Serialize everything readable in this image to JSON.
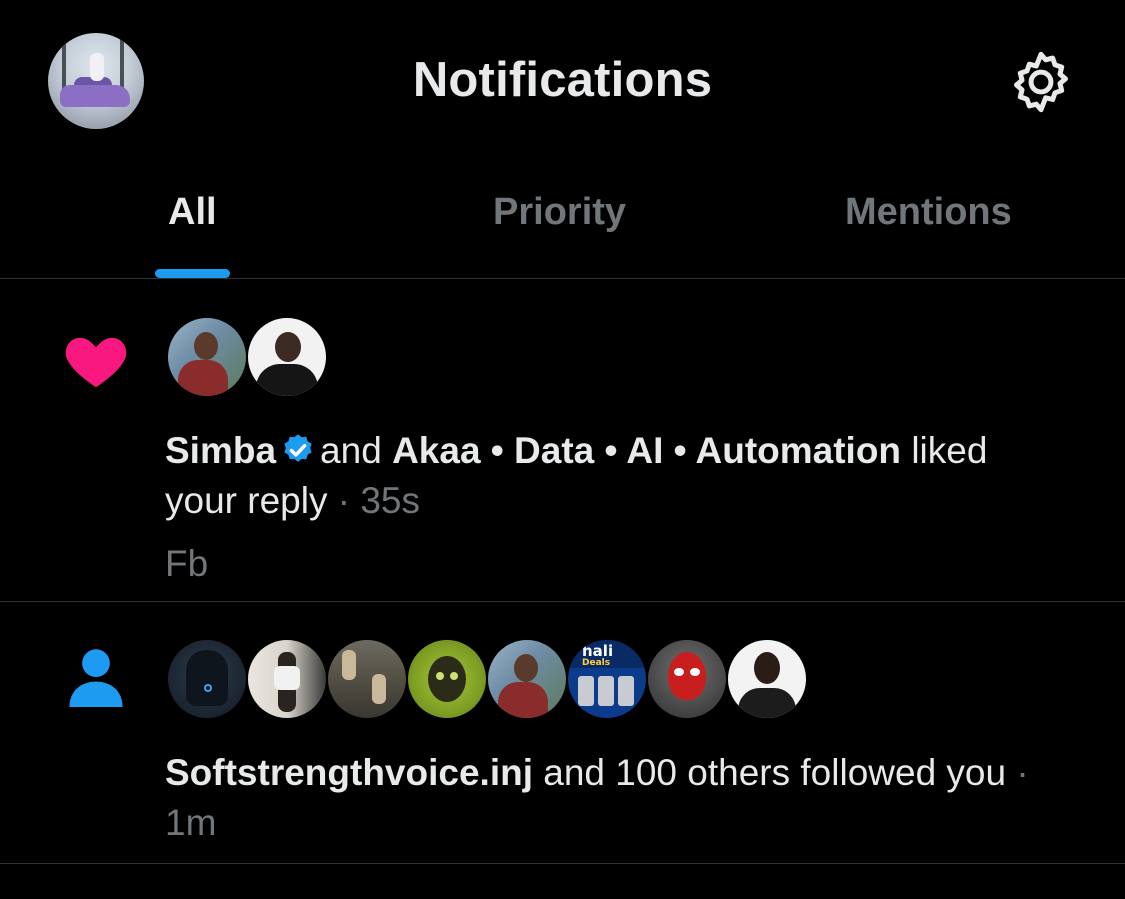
{
  "header": {
    "title": "Notifications",
    "profile_icon": "avatar",
    "settings_icon": "gear-icon"
  },
  "tabs": [
    {
      "label": "All",
      "active": true
    },
    {
      "label": "Priority",
      "active": false
    },
    {
      "label": "Mentions",
      "active": false
    }
  ],
  "colors": {
    "accent": "#1d9bf0",
    "like": "#f91880",
    "muted": "#71767b",
    "text": "#e7e9ea",
    "background": "#000000",
    "divider": "#2f3336"
  },
  "notifications": [
    {
      "type_icon": "heart-icon",
      "avatar_count": 2,
      "user1": "Simba",
      "user1_verified": true,
      "connector": "and",
      "user2": "Akaa • Data • AI • Automation",
      "action_line1": "liked",
      "action_line2": "your reply",
      "time": "· 35s",
      "snippet": "Fb"
    },
    {
      "type_icon": "person-icon",
      "avatar_count": 8,
      "user1": "Softstrengthvoice.inj",
      "action": "and 100 others followed you",
      "time_sep": "·",
      "time": "1m",
      "avatar_badge_text": "hali",
      "avatar_badge_subtext": "Deals"
    }
  ]
}
